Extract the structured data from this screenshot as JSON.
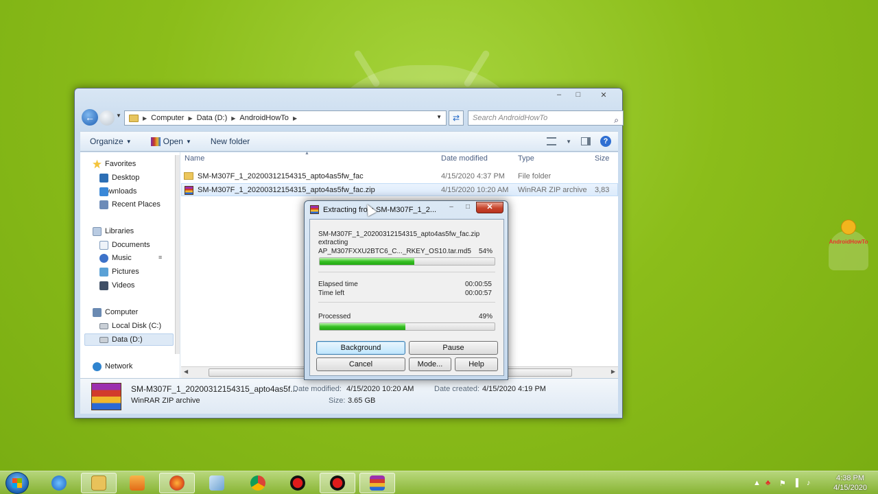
{
  "explorer": {
    "breadcrumb": [
      "Computer",
      "Data (D:)",
      "AndroidHowTo"
    ],
    "search_placeholder": "Search AndroidHowTo",
    "toolbar": {
      "organize": "Organize",
      "open": "Open",
      "new_folder": "New folder"
    },
    "nav": {
      "favorites": "Favorites",
      "desktop": "Desktop",
      "downloads": "Downloads",
      "recent_places": "Recent Places",
      "libraries": "Libraries",
      "documents": "Documents",
      "music": "Music",
      "pictures": "Pictures",
      "videos": "Videos",
      "computer": "Computer",
      "local_disk": "Local Disk (C:)",
      "data_disk": "Data (D:)",
      "network": "Network"
    },
    "columns": {
      "name": "Name",
      "date_modified": "Date modified",
      "type": "Type",
      "size": "Size"
    },
    "files": [
      {
        "name": "SM-M307F_1_20200312154315_apto4as5fw_fac",
        "date": "4/15/2020 4:37 PM",
        "type": "File folder",
        "size": ""
      },
      {
        "name": "SM-M307F_1_20200312154315_apto4as5fw_fac.zip",
        "date": "4/15/2020 10:20 AM",
        "type": "WinRAR ZIP archive",
        "size": "3,83"
      }
    ],
    "details": {
      "filename": "SM-M307F_1_20200312154315_apto4as5f...",
      "filetype": "WinRAR ZIP archive",
      "date_modified_label": "Date modified:",
      "date_modified": "4/15/2020 10:20 AM",
      "size_label": "Size:",
      "size": "3.65 GB",
      "date_created_label": "Date created:",
      "date_created": "4/15/2020 4:19 PM"
    }
  },
  "dialog": {
    "title": "Extracting from SM-M307F_1_2...",
    "archive": "SM-M307F_1_20200312154315_apto4as5fw_fac.zip",
    "status": "extracting",
    "current_file": "AP_M307FXXU2BTC6_C..._RKEY_OS10.tar.md5",
    "file_percent_label": "54%",
    "file_progress": 54,
    "elapsed_label": "Elapsed time",
    "elapsed": "00:00:55",
    "left_label": "Time left",
    "left": "00:00:57",
    "processed_label": "Processed",
    "processed_percent_label": "49%",
    "processed_progress": 49,
    "buttons": {
      "background": "Background",
      "pause": "Pause",
      "cancel": "Cancel",
      "mode": "Mode...",
      "help": "Help"
    }
  },
  "watermark": "AndroidHowTo",
  "taskbar": {
    "apps": [
      "start-button",
      "internet-explorer",
      "file-explorer",
      "media-player",
      "firefox",
      "notepad",
      "chrome",
      "recorder",
      "recorder-2",
      "winrar"
    ],
    "clock_time": "4:38 PM",
    "clock_date": "4/15/2020"
  }
}
